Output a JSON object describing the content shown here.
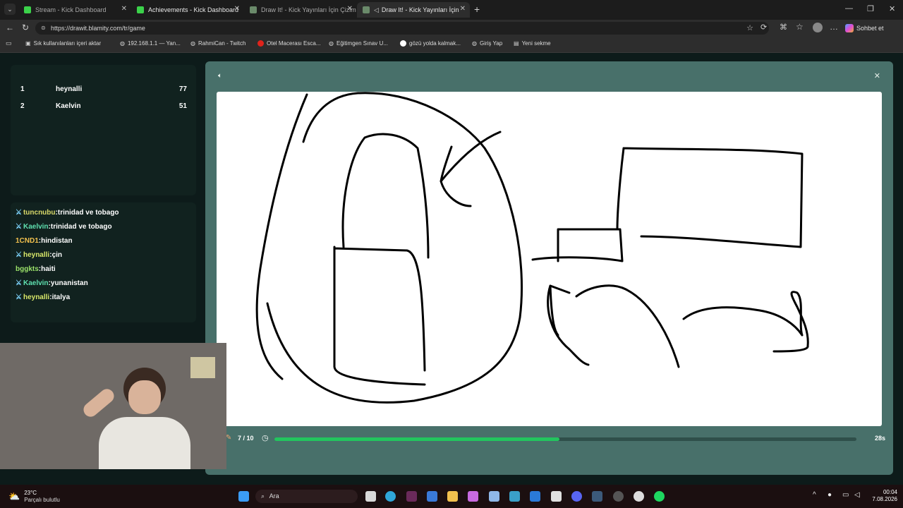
{
  "browser": {
    "tabs": [
      {
        "title": "Stream - Kick Dashboard",
        "active": false
      },
      {
        "title": "Achievements - Kick Dashboard",
        "active": false
      },
      {
        "title": "Draw It! - Kick Yayınları İçin Çizim",
        "active": false
      },
      {
        "title": "Draw It! - Kick Yayınları İçin Ç",
        "active": true
      }
    ],
    "url": "https://drawit.blamity.com/tr/game",
    "profile_button": "Sohbet et",
    "bookmarks": [
      "Sık kullanılanları içeri aktar",
      "192.168.1.1 — Yan...",
      "RahmiCan - Twitch",
      "Otel Macerası Esca...",
      "Eğitimgen Sınav U...",
      "gözü yolda kalmak...",
      "Giriş Yap",
      "Yeni sekme"
    ]
  },
  "leaderboard": [
    {
      "rank": "1",
      "name": "heynalli",
      "points": "77"
    },
    {
      "rank": "2",
      "name": "Kaelvin",
      "points": "51"
    }
  ],
  "chat": [
    {
      "user": "tuncnubu",
      "text": "trinidad ve tobago",
      "badge": true,
      "color": "#d9d96a"
    },
    {
      "user": "Kaelvin",
      "text": "trinidad ve tobago",
      "badge": true,
      "color": "#5fe0b0"
    },
    {
      "user": "1CND1",
      "text": "hindistan",
      "badge": false,
      "color": "#f2c14e"
    },
    {
      "user": "heynalli",
      "text": "çin",
      "badge": true,
      "color": "#d9e86a"
    },
    {
      "user": "bggkts",
      "text": "haiti",
      "badge": false,
      "color": "#9be36a"
    },
    {
      "user": "Kaelvin",
      "text": "yunanistan",
      "badge": true,
      "color": "#5fe0b0"
    },
    {
      "user": "heynalli",
      "text": "italya",
      "badge": true,
      "color": "#d9e86a"
    }
  ],
  "game": {
    "round": "7 / 10",
    "timer": "28s",
    "progress": 0.49,
    "accent": "#22c55e"
  },
  "taskbar": {
    "weather_temp": "23°C",
    "weather_desc": "Parçalı bulutlu",
    "search": "Ara",
    "time": "00:04",
    "date": "7.08.2026"
  }
}
